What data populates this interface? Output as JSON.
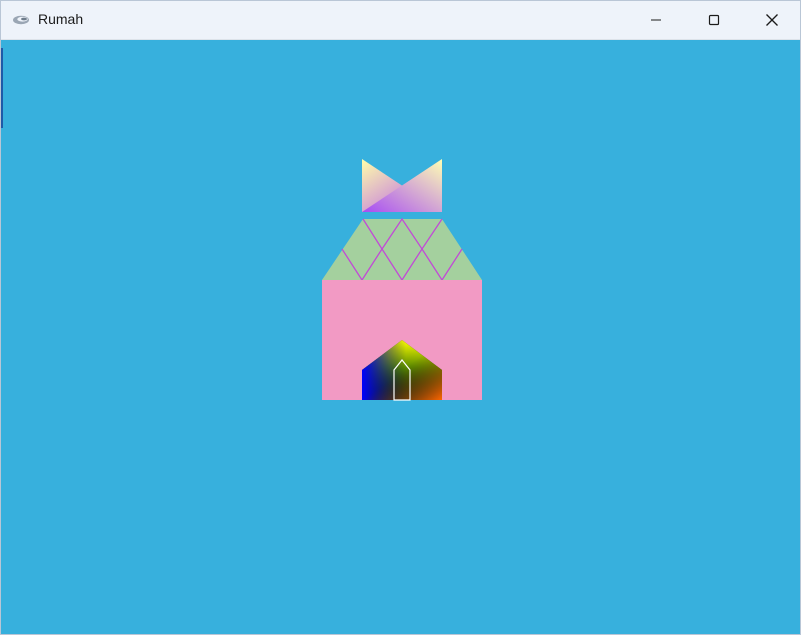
{
  "window": {
    "title": "Rumah",
    "icon": "eclipse-app-icon",
    "controls": {
      "minimize": "minimize-icon",
      "maximize": "maximize-icon",
      "close": "close-icon"
    }
  },
  "colors": {
    "background": "#37b0dd",
    "house_wall": "#f29ac4",
    "roof": "#a4d09e",
    "roof_pattern": "#c14ad6",
    "crown_light": "#ffffb0",
    "crown_purple": "#a855f7",
    "door_outline": "#ffffff"
  }
}
